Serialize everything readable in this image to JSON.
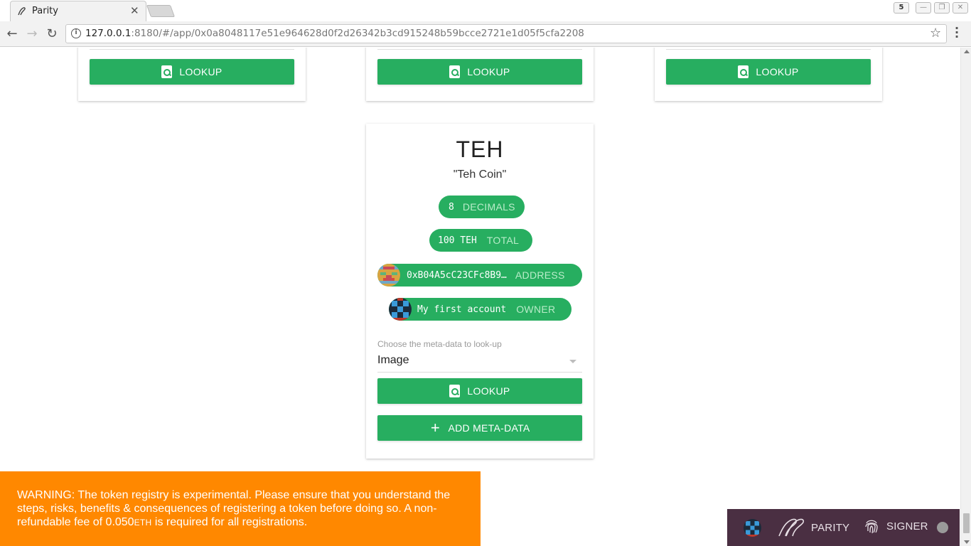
{
  "browser": {
    "tab_title": "Parity",
    "tab_close": "✕",
    "url_host": "127.0.0.1",
    "url_rest": ":8180/#/app/0x0a8048117e51e964628d0f2d26342b3cd915248b59bcce2721e1d05f5cfa2208",
    "extension_badge": "5"
  },
  "top_cards": [
    {
      "lookup_label": "LOOKUP"
    },
    {
      "lookup_label": "LOOKUP"
    },
    {
      "lookup_label": "LOOKUP"
    }
  ],
  "token": {
    "symbol": "TEH",
    "name": "\"Teh Coin\"",
    "decimals_value": "8",
    "decimals_label": "DECIMALS",
    "total_value": "100 TEH",
    "total_label": "TOTAL",
    "address_value": "0xB04A5cC23CFc8B9…",
    "address_label": "ADDRESS",
    "owner_value": "My first account",
    "owner_label": "OWNER",
    "metadata_select_label": "Choose the meta-data to look-up",
    "metadata_select_value": "Image",
    "lookup_label": "LOOKUP",
    "add_metadata_label": "ADD META-DATA"
  },
  "warning": {
    "text_before": "WARNING: The token registry is experimental. Please ensure that you understand the steps, risks, benefits & consequences of registering a token before doing so. A non-refundable fee of 0.050",
    "unit": "ETH",
    "text_after": " is required for all registrations."
  },
  "statusbar": {
    "parity_label": "PARITY",
    "signer_label": "SIGNER"
  },
  "colors": {
    "accent_green": "#27ae60",
    "warning_orange": "#ff8800",
    "statusbar_bg": "#4a2f42"
  }
}
